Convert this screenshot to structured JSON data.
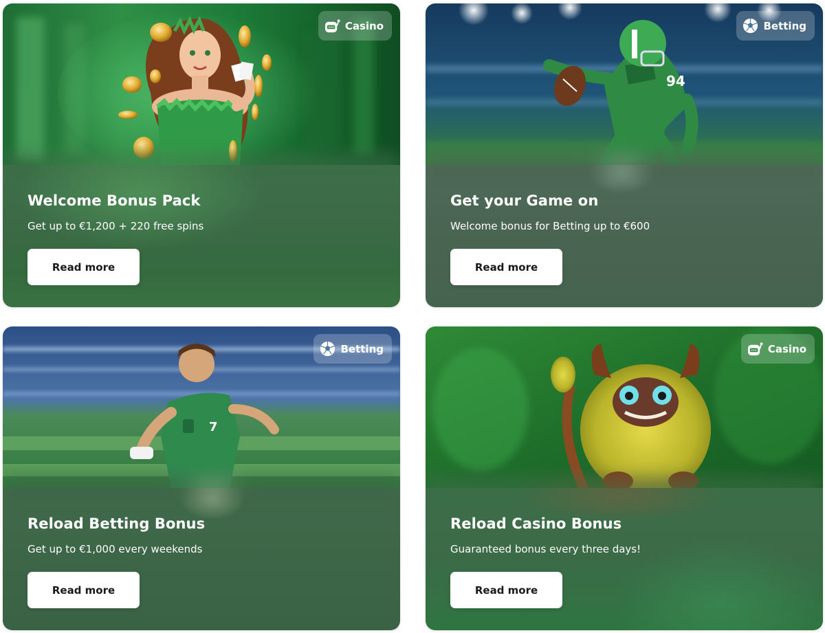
{
  "colors": {
    "page_background": "#ffffff",
    "button_background": "#ffffff",
    "button_text": "#1a1a1a",
    "title_text": "#ffffff",
    "badge_background": "rgba(255,255,255,0.22)"
  },
  "cards": [
    {
      "badge": {
        "label": "Casino",
        "icon": "slot-machine-icon"
      },
      "title": "Welcome Bonus Pack",
      "subtitle": "Get up to €1,200 + 220 free spins",
      "button_label": "Read more"
    },
    {
      "badge": {
        "label": "Betting",
        "icon": "soccer-ball-icon"
      },
      "title": "Get your Game on",
      "subtitle": "Welcome bonus for Betting up to €600",
      "button_label": "Read more"
    },
    {
      "badge": {
        "label": "Betting",
        "icon": "soccer-ball-icon"
      },
      "title": "Reload Betting Bonus",
      "subtitle": "Get up to €1,000 every weekends",
      "button_label": "Read more"
    },
    {
      "badge": {
        "label": "Casino",
        "icon": "slot-machine-icon"
      },
      "title": "Reload Casino Bonus",
      "subtitle": "Guaranteed bonus every three days!",
      "button_label": "Read more"
    }
  ]
}
